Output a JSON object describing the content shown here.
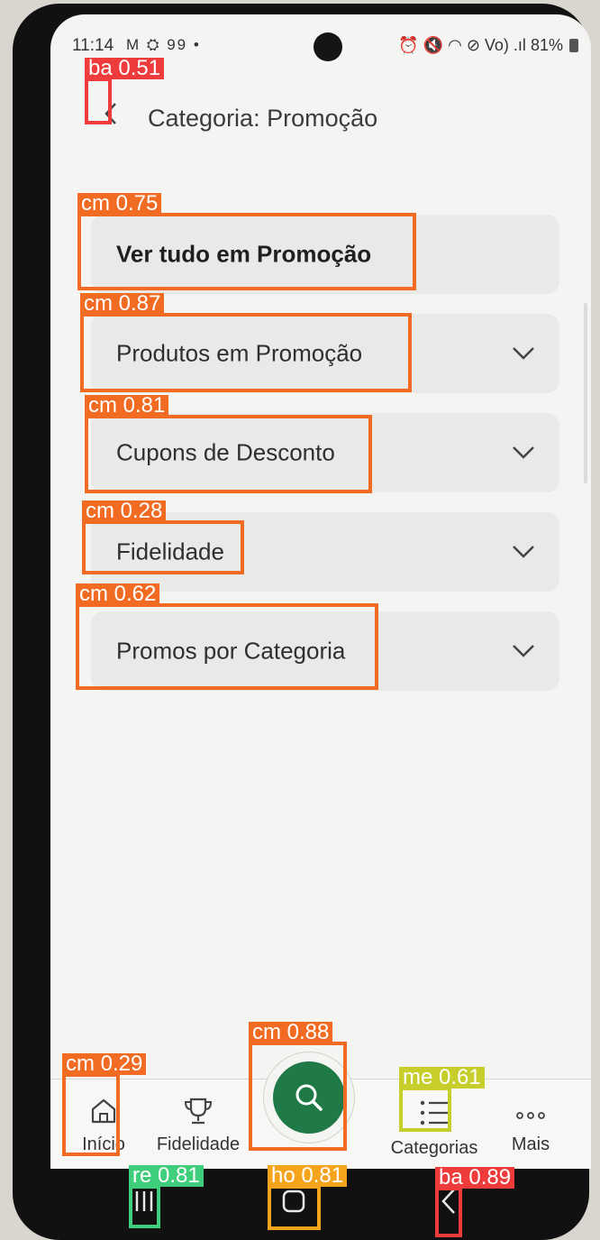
{
  "status_bar": {
    "time": "11:14",
    "left_icons": "M ⛭ 99 •",
    "right_icons": "⏰ 🔇 ◠ ⊘ Vo) .ıl",
    "battery": "81%"
  },
  "header": {
    "title": "Categoria: Promoção",
    "back_icon": "chevron-left-icon"
  },
  "categories": [
    {
      "label": "Ver tudo em Promoção",
      "expandable": false
    },
    {
      "label": "Produtos em Promoção",
      "expandable": true
    },
    {
      "label": "Cupons de Desconto",
      "expandable": true
    },
    {
      "label": "Fidelidade",
      "expandable": true
    },
    {
      "label": "Promos por Categoria",
      "expandable": true
    }
  ],
  "bottom_nav": {
    "inicio": "Início",
    "fidelidade": "Fidelidade",
    "categorias": "Categorias",
    "mais": "Mais",
    "search_icon": "search-icon"
  },
  "colors": {
    "accent_green": "#1f7a48",
    "detection_orange": "#f26b22",
    "detection_red": "#ee3b3b",
    "detection_green": "#3fcf7c",
    "detection_amber": "#f7a41d",
    "detection_lime": "#c7cd2b"
  },
  "detections": [
    {
      "tag": "ba 0.51"
    },
    {
      "tag": "cm 0.75"
    },
    {
      "tag": "cm 0.87"
    },
    {
      "tag": "cm 0.81"
    },
    {
      "tag": "cm 0.28"
    },
    {
      "tag": "cm 0.62"
    },
    {
      "tag": "cm 0.29"
    },
    {
      "tag": "cm 0.88"
    },
    {
      "tag": "me 0.61"
    },
    {
      "tag": "re 0.81"
    },
    {
      "tag": "ho 0.81"
    },
    {
      "tag": "ba 0.89"
    }
  ]
}
